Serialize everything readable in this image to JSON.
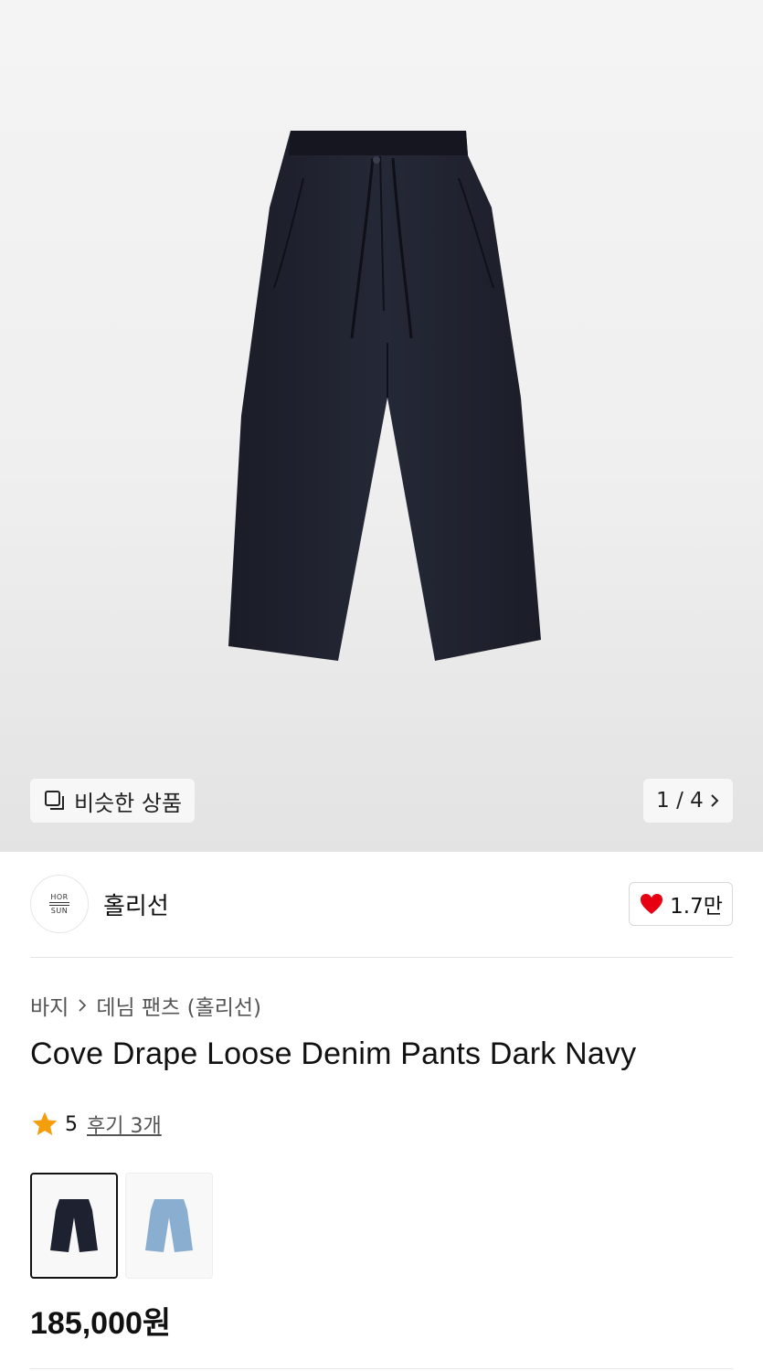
{
  "gallery": {
    "similar_label": "비슷한 상품",
    "pager": "1 / 4",
    "image_alt": "dark-navy-denim-pants-photo"
  },
  "brand": {
    "name": "홀리선",
    "logo_top": "HOR",
    "logo_bottom": "SUN",
    "likes": "1.7만"
  },
  "breadcrumb": {
    "level1": "바지",
    "level2": "데님 팬츠 (홀리선)"
  },
  "product": {
    "title": "Cove Drape Loose Denim Pants Dark Navy",
    "rating": "5",
    "reviews": "후기 3개",
    "price": "185,000원"
  },
  "swatches": [
    {
      "color_name": "dark-navy",
      "color": "#1e2130",
      "selected": true
    },
    {
      "color_name": "light-blue",
      "color": "#8aaed0",
      "selected": false
    }
  ],
  "colors": {
    "heart": "#e60012",
    "star": "#f59e0b"
  }
}
